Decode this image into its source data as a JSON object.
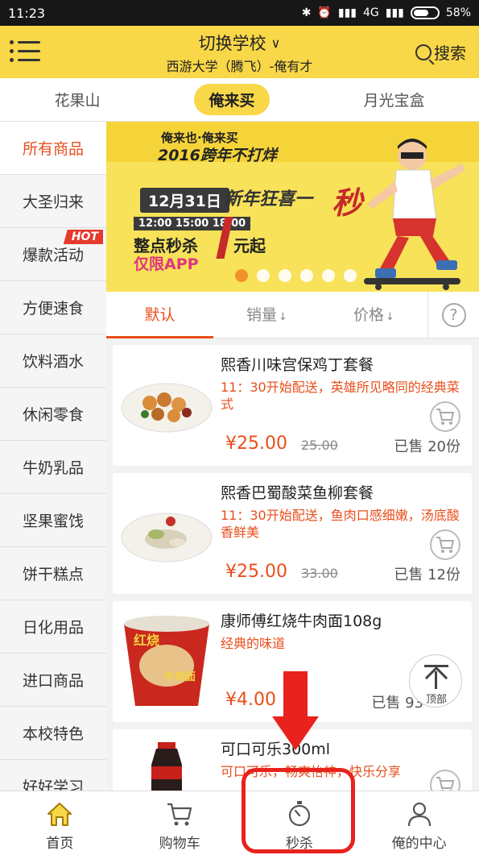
{
  "status_bar": {
    "time": "11:23",
    "network": "4G",
    "battery": "58%"
  },
  "header": {
    "title": "切换学校",
    "subtitle": "西游大学（腾飞）-俺有才",
    "search_label": "搜索"
  },
  "store_tabs": [
    {
      "label": "花果山",
      "active": false
    },
    {
      "label": "俺来买",
      "active": true
    },
    {
      "label": "月光宝盒",
      "active": false
    }
  ],
  "sidebar": {
    "items": [
      {
        "label": "所有商品"
      },
      {
        "label": "大圣归来"
      },
      {
        "label": "爆款活动",
        "badge": "HOT"
      },
      {
        "label": "方便速食"
      },
      {
        "label": "饮料酒水"
      },
      {
        "label": "休闲零食"
      },
      {
        "label": "牛奶乳品"
      },
      {
        "label": "坚果蜜饯"
      },
      {
        "label": "饼干糕点"
      },
      {
        "label": "日化用品"
      },
      {
        "label": "进口商品"
      },
      {
        "label": "本校特色"
      },
      {
        "label": "好好学习"
      }
    ]
  },
  "banner": {
    "brand": "俺来也·俺来买",
    "slogan": "2016跨年不打烊",
    "date": "12月31日",
    "headline": "新年狂喜一",
    "headline_highlight": "秒",
    "times": "12:00 15:00 18:00",
    "flash": "整点秒杀",
    "from_price": "元起",
    "app_only": "仅限APP",
    "slide_count": 6,
    "active_slide": 0
  },
  "sort_bar": {
    "default_label": "默认",
    "sales_label": "销量",
    "price_label": "价格",
    "down_arrow": "↓",
    "help_label": "?"
  },
  "products": [
    {
      "name": "熙香川味宫保鸡丁套餐",
      "desc": "11：30开始配送，英雄所见略同的经典菜式",
      "price": "¥25.00",
      "old_price": "25.00",
      "sold": "已售 20份"
    },
    {
      "name": "熙香巴蜀酸菜鱼柳套餐",
      "desc": "11：30开始配送，鱼肉口感细嫩，汤底酸香鲜美",
      "price": "¥25.00",
      "old_price": "33.00",
      "sold": "已售 12份"
    },
    {
      "name": "康师傅红烧牛肉面108g",
      "desc": "经典的味道",
      "price": "¥4.00",
      "old_price": "",
      "sold": "已售 93"
    },
    {
      "name": "可口可乐300ml",
      "desc": "可口可乐，畅爽怡神，快乐分享",
      "price": "",
      "old_price": "",
      "sold": ""
    }
  ],
  "back_to_top": "顶部",
  "bottom_nav": [
    {
      "label": "首页",
      "icon": "home-icon",
      "active": true
    },
    {
      "label": "购物车",
      "icon": "cart-icon",
      "active": false
    },
    {
      "label": "秒杀",
      "icon": "stopwatch-icon",
      "active": false
    },
    {
      "label": "俺的中心",
      "icon": "user-icon",
      "active": false
    }
  ],
  "colors": {
    "brand_yellow": "#f8d748",
    "accent_orange": "#e94e1b",
    "annotation_red": "#e8221d"
  }
}
